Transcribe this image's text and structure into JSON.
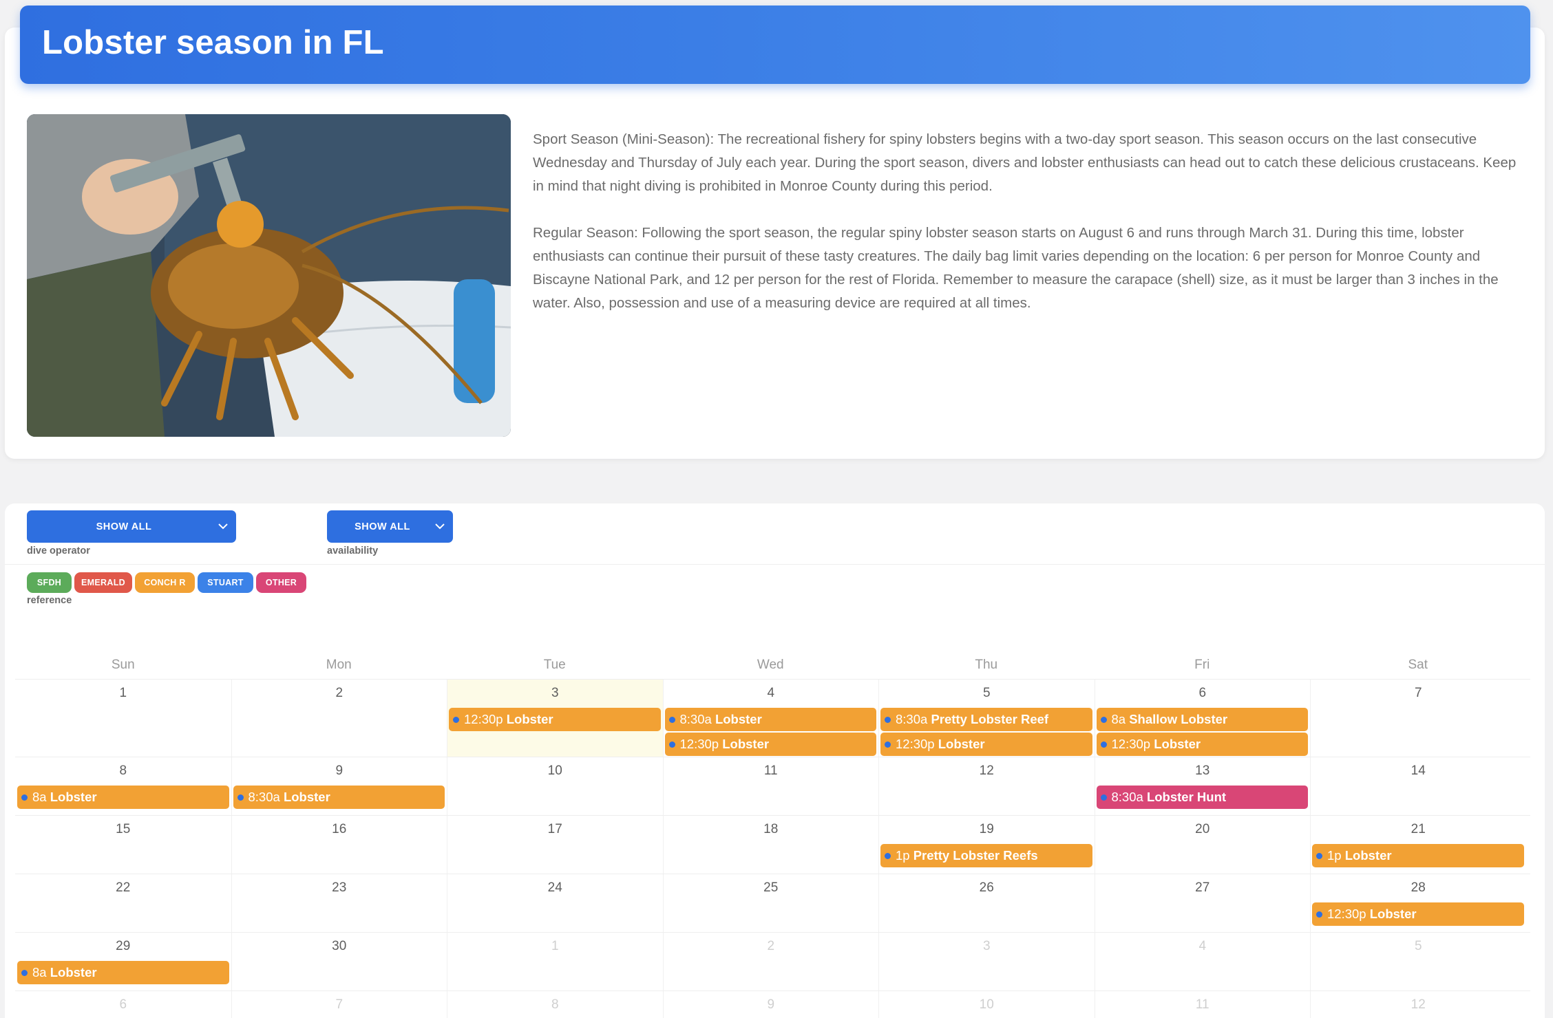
{
  "header": {
    "title": "Lobster season in FL"
  },
  "description": {
    "p1": "Sport Season (Mini-Season): The recreational fishery for spiny lobsters begins with a two-day sport season. This season occurs on the last consecutive Wednesday and Thursday of July each year. During the sport season, divers and lobster enthusiasts can head out to catch these delicious crustaceans. Keep in mind that night diving is prohibited in Monroe County during this period.",
    "p2": "Regular Season: Following the sport season, the regular spiny lobster season starts on August 6 and runs through March 31. During this time, lobster enthusiasts can continue their pursuit of these tasty creatures. The daily bag limit varies depending on the location: 6 per person for Monroe County and Biscayne National Park, and 12 per person for the rest of Florida. Remember to measure the carapace (shell) size, as it must be larger than 3 inches in the water. Also, possession and use of a measuring device are required at all times."
  },
  "filters": {
    "operator": {
      "value": "SHOW ALL",
      "label": "dive operator"
    },
    "availability": {
      "value": "SHOW ALL",
      "label": "availability"
    }
  },
  "reference": {
    "label": "reference",
    "chips": [
      {
        "text": "SFDH",
        "color": "#5cab5a"
      },
      {
        "text": "EMERALD",
        "color": "#e0584a"
      },
      {
        "text": "CONCH R",
        "color": "#f2a134"
      },
      {
        "text": "STUART",
        "color": "#3b82e8"
      },
      {
        "text": "OTHER",
        "color": "#d94676"
      }
    ]
  },
  "calendar": {
    "days_of_week": [
      "Sun",
      "Mon",
      "Tue",
      "Wed",
      "Thu",
      "Fri",
      "Sat"
    ],
    "weeks": [
      {
        "days": [
          {
            "n": "1"
          },
          {
            "n": "2"
          },
          {
            "n": "3",
            "today": true
          },
          {
            "n": "4"
          },
          {
            "n": "5"
          },
          {
            "n": "6"
          },
          {
            "n": "7"
          }
        ],
        "events": [
          {
            "col": 2,
            "slot": 0,
            "time": "12:30p",
            "title": "Lobster",
            "color": "#f2a134"
          },
          {
            "col": 3,
            "slot": 0,
            "time": "8:30a",
            "title": "Lobster",
            "color": "#f2a134"
          },
          {
            "col": 3,
            "slot": 1,
            "time": "12:30p",
            "title": "Lobster",
            "color": "#f2a134"
          },
          {
            "col": 4,
            "slot": 0,
            "time": "8:30a",
            "title": "Pretty Lobster Reef",
            "color": "#f2a134"
          },
          {
            "col": 4,
            "slot": 1,
            "time": "12:30p",
            "title": "Lobster",
            "color": "#f2a134"
          },
          {
            "col": 5,
            "slot": 0,
            "time": "8a",
            "title": "Shallow Lobster",
            "color": "#f2a134"
          },
          {
            "col": 5,
            "slot": 1,
            "time": "12:30p",
            "title": "Lobster",
            "color": "#f2a134"
          }
        ]
      },
      {
        "days": [
          {
            "n": "8"
          },
          {
            "n": "9"
          },
          {
            "n": "10"
          },
          {
            "n": "11"
          },
          {
            "n": "12"
          },
          {
            "n": "13"
          },
          {
            "n": "14"
          }
        ],
        "events": [
          {
            "col": 0,
            "slot": 0,
            "time": "8a",
            "title": "Lobster",
            "color": "#f2a134"
          },
          {
            "col": 1,
            "slot": 0,
            "time": "8:30a",
            "title": "Lobster",
            "color": "#f2a134"
          },
          {
            "col": 5,
            "slot": 0,
            "time": "8:30a",
            "title": "Lobster Hunt",
            "color": "#d94676"
          }
        ]
      },
      {
        "days": [
          {
            "n": "15"
          },
          {
            "n": "16"
          },
          {
            "n": "17"
          },
          {
            "n": "18"
          },
          {
            "n": "19"
          },
          {
            "n": "20"
          },
          {
            "n": "21"
          }
        ],
        "events": [
          {
            "col": 4,
            "slot": 0,
            "time": "1p",
            "title": "Pretty Lobster Reefs",
            "color": "#f2a134"
          },
          {
            "col": 6,
            "slot": 0,
            "time": "1p",
            "title": "Lobster",
            "color": "#f2a134"
          }
        ]
      },
      {
        "days": [
          {
            "n": "22"
          },
          {
            "n": "23"
          },
          {
            "n": "24"
          },
          {
            "n": "25"
          },
          {
            "n": "26"
          },
          {
            "n": "27"
          },
          {
            "n": "28"
          }
        ],
        "events": [
          {
            "col": 6,
            "slot": 0,
            "time": "12:30p",
            "title": "Lobster",
            "color": "#f2a134"
          }
        ]
      },
      {
        "days": [
          {
            "n": "29"
          },
          {
            "n": "30"
          },
          {
            "n": "1",
            "other": true
          },
          {
            "n": "2",
            "other": true
          },
          {
            "n": "3",
            "other": true
          },
          {
            "n": "4",
            "other": true
          },
          {
            "n": "5",
            "other": true
          }
        ],
        "events": [
          {
            "col": 0,
            "slot": 0,
            "time": "8a",
            "title": "Lobster",
            "color": "#f2a134"
          }
        ]
      },
      {
        "days": [
          {
            "n": "6",
            "other": true
          },
          {
            "n": "7",
            "other": true
          },
          {
            "n": "8",
            "other": true
          },
          {
            "n": "9",
            "other": true
          },
          {
            "n": "10",
            "other": true
          },
          {
            "n": "11",
            "other": true
          },
          {
            "n": "12",
            "other": true
          }
        ],
        "events": []
      }
    ]
  }
}
